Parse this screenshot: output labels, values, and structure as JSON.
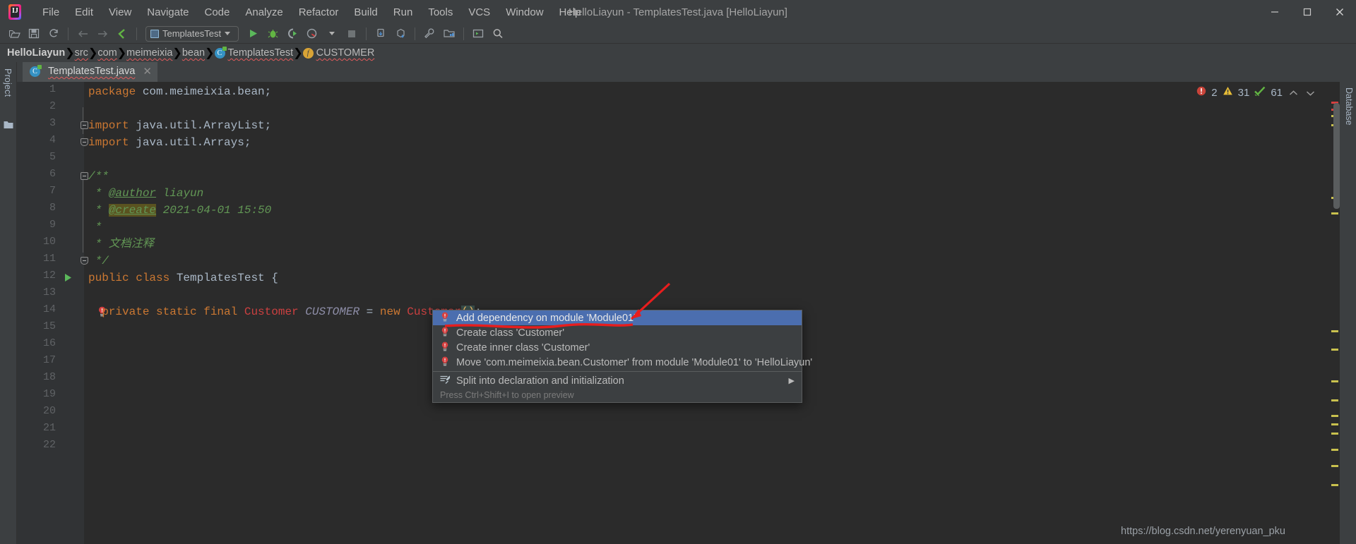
{
  "window": {
    "title": "HelloLiayun - TemplatesTest.java [HelloLiayun]",
    "minimize": "–",
    "maximize": "▢",
    "close": "✕"
  },
  "menubar": {
    "items": [
      {
        "label": "File",
        "icon": "file-menu"
      },
      {
        "label": "Edit",
        "icon": "edit-menu"
      },
      {
        "label": "View",
        "icon": "view-menu"
      },
      {
        "label": "Navigate",
        "icon": "navigate-menu"
      },
      {
        "label": "Code",
        "icon": "code-menu"
      },
      {
        "label": "Analyze",
        "icon": "analyze-menu"
      },
      {
        "label": "Refactor",
        "icon": "refactor-menu"
      },
      {
        "label": "Build",
        "icon": "build-menu"
      },
      {
        "label": "Run",
        "icon": "run-menu"
      },
      {
        "label": "Tools",
        "icon": "tools-menu"
      },
      {
        "label": "VCS",
        "icon": "vcs-menu"
      },
      {
        "label": "Window",
        "icon": "window-menu"
      },
      {
        "label": "Help",
        "icon": "help-menu"
      }
    ]
  },
  "toolbar": {
    "run_config": "TemplatesTest",
    "icons": [
      "open-folder-icon",
      "save-all-icon",
      "sync-refresh-icon",
      "navigate-back-icon",
      "navigate-forward-icon",
      "last-edit-location-icon",
      "run-icon",
      "debug-icon",
      "run-with-coverage-icon",
      "profiler-icon",
      "stop-icon",
      "update-project-icon",
      "commit-icon",
      "settings-wrench-icon",
      "project-structure-icon",
      "select-in-icon",
      "search-everywhere-icon"
    ]
  },
  "breadcrumb": {
    "items": [
      {
        "label": "HelloLiayun",
        "icon": "",
        "bold": true,
        "squiggly": false
      },
      {
        "label": "src",
        "icon": "",
        "bold": false,
        "squiggly": true
      },
      {
        "label": "com",
        "icon": "",
        "bold": false,
        "squiggly": true
      },
      {
        "label": "meimeixia",
        "icon": "",
        "bold": false,
        "squiggly": true
      },
      {
        "label": "bean",
        "icon": "",
        "bold": false,
        "squiggly": true
      },
      {
        "label": "TemplatesTest",
        "icon": "class-icon",
        "bold": false,
        "squiggly": true
      },
      {
        "label": "CUSTOMER",
        "icon": "field-icon",
        "bold": false,
        "squiggly": true
      }
    ],
    "separator": "❯"
  },
  "left_stripe": {
    "project_label": "Project",
    "folder_icon": "folder-icon"
  },
  "right_stripe": {
    "database_label": "Database"
  },
  "editor_tab": {
    "filename": "TemplatesTest.java",
    "icon": "java-class-icon",
    "close": "✕"
  },
  "inspection_hud": {
    "error_count": "2",
    "warning_count": "31",
    "ok_count": "61",
    "error_color": "#c9443a",
    "warning_color": "#e8bd36",
    "ok_color": "#62b543",
    "prev_chevron": "⌃",
    "next_chevron": "⌄"
  },
  "code": {
    "lines": [
      {
        "n": 1,
        "segments": [
          {
            "t": "package ",
            "c": "kw"
          },
          {
            "t": "com.meimeixia.bean;",
            "c": "plain"
          }
        ]
      },
      {
        "n": 2,
        "segments": []
      },
      {
        "n": 3,
        "segments": [
          {
            "t": "import ",
            "c": "kw"
          },
          {
            "t": "java.util.ArrayList;",
            "c": "plain"
          }
        ],
        "fold": "open"
      },
      {
        "n": 4,
        "segments": [
          {
            "t": "import ",
            "c": "kw"
          },
          {
            "t": "java.util.Arrays;",
            "c": "plain"
          }
        ],
        "fold": "end"
      },
      {
        "n": 5,
        "segments": []
      },
      {
        "n": 6,
        "segments": [
          {
            "t": "/**",
            "c": "cmt"
          }
        ],
        "fold": "open"
      },
      {
        "n": 7,
        "segments": [
          {
            "t": " * ",
            "c": "cmt"
          },
          {
            "t": "@author",
            "c": "cmt-tag"
          },
          {
            "t": " liayun",
            "c": "cmt"
          }
        ]
      },
      {
        "n": 8,
        "segments": [
          {
            "t": " * ",
            "c": "cmt"
          },
          {
            "t": "@create",
            "c": "cmt-tag-hl"
          },
          {
            "t": " 2021-04-01 15:50",
            "c": "cmt"
          }
        ]
      },
      {
        "n": 9,
        "segments": [
          {
            "t": " *",
            "c": "cmt"
          }
        ]
      },
      {
        "n": 10,
        "segments": [
          {
            "t": " * 文档注释",
            "c": "cmt"
          }
        ]
      },
      {
        "n": 11,
        "segments": [
          {
            "t": " */",
            "c": "cmt"
          }
        ],
        "fold": "end"
      },
      {
        "n": 12,
        "segments": [
          {
            "t": "public class ",
            "c": "kw"
          },
          {
            "t": "TemplatesTest {",
            "c": "plain"
          }
        ],
        "gutter_mark": "run-gutter-icon"
      },
      {
        "n": 13,
        "segments": []
      },
      {
        "n": 14,
        "segments": [
          {
            "t": "  ",
            "c": "plain"
          },
          {
            "t": "private static final ",
            "c": "kw"
          },
          {
            "t": "Customer",
            "c": "err"
          },
          {
            "t": " ",
            "c": "plain"
          },
          {
            "t": "CUSTOMER",
            "c": "consts"
          },
          {
            "t": " = ",
            "c": "plain"
          },
          {
            "t": "new ",
            "c": "kw"
          },
          {
            "t": "Customer",
            "c": "err"
          },
          {
            "t": "()",
            "c": "brace-hl"
          },
          {
            "t": ";",
            "c": "plain"
          }
        ],
        "gutter_mark": "error-bulb-icon"
      },
      {
        "n": 15,
        "segments": []
      },
      {
        "n": 16,
        "segments": []
      },
      {
        "n": 17,
        "segments": []
      },
      {
        "n": 18,
        "segments": []
      },
      {
        "n": 19,
        "segments": []
      },
      {
        "n": 20,
        "segments": []
      },
      {
        "n": 21,
        "segments": []
      },
      {
        "n": 22,
        "segments": []
      }
    ]
  },
  "intention_popup": {
    "items": [
      {
        "label": "Add dependency on module 'Module01'",
        "icon": "error-bulb-icon",
        "selected": true,
        "submenu": false
      },
      {
        "label": "Create class 'Customer'",
        "icon": "error-bulb-icon",
        "selected": false,
        "submenu": false
      },
      {
        "label": "Create inner class 'Customer'",
        "icon": "error-bulb-icon",
        "selected": false,
        "submenu": false
      },
      {
        "label": "Move 'com.meimeixia.bean.Customer' from module 'Module01' to 'HelloLiayun'",
        "icon": "error-bulb-icon",
        "selected": false,
        "submenu": false
      },
      {
        "label": "Split into declaration and initialization",
        "icon": "intention-action-icon",
        "selected": false,
        "submenu": true,
        "separator_before": true
      }
    ],
    "footer": "Press Ctrl+Shift+I to open preview",
    "submenu_arrow": "▶",
    "selection_color": "#4b6eaf"
  },
  "annotation": {
    "type": "red-arrow-and-underline",
    "color": "#e81d1d"
  },
  "watermark": "https://blog.csdn.net/yerenyuan_pku"
}
